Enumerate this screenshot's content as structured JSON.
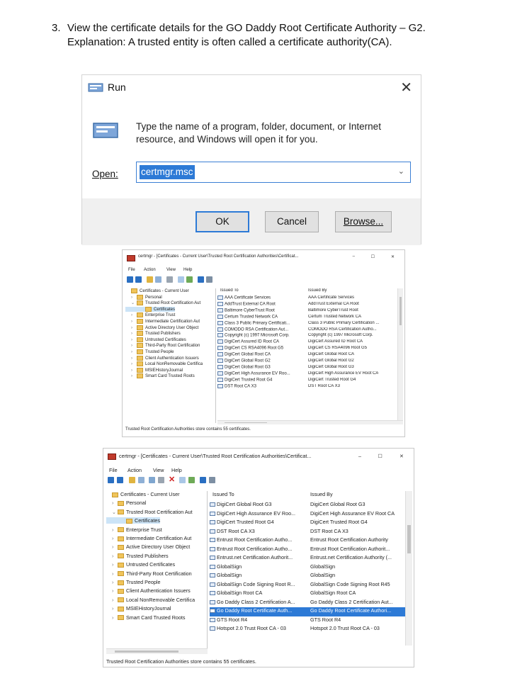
{
  "doc": {
    "step_number": "3.",
    "line1": "View the certificate details for the GO Daddy Root Certificate Authority – G2.",
    "line2": "Explanation: A trusted entity is often called a certificate authority(CA)."
  },
  "run_dialog": {
    "title": "Run",
    "close": "✕",
    "description": "Type the name of a program, folder, document, or Internet resource, and Windows will open it for you.",
    "open_label": "Open:",
    "open_value": "certmgr.msc",
    "ok_label": "OK",
    "cancel_label": "Cancel",
    "browse_label": "Browse..."
  },
  "certmgr1": {
    "title": "certmgr - [Certificates - Current User\\Trusted Root Certification Authorities\\Certificat...",
    "minimize": "–",
    "maximize": "☐",
    "close": "✕",
    "menu": [
      "File",
      "Action",
      "View",
      "Help"
    ],
    "tree": [
      {
        "label": "Certificates - Current User",
        "arrow": ""
      },
      {
        "label": "Personal",
        "arrow": "›"
      },
      {
        "label": "Trusted Root Certification Aut",
        "arrow": "⌄"
      },
      {
        "label": "Certificates",
        "arrow": ""
      },
      {
        "label": "Enterprise Trust",
        "arrow": "›"
      },
      {
        "label": "Intermediate Certification Aut",
        "arrow": "›"
      },
      {
        "label": "Active Directory User Object",
        "arrow": "›"
      },
      {
        "label": "Trusted Publishers",
        "arrow": "›"
      },
      {
        "label": "Untrusted Certificates",
        "arrow": "›"
      },
      {
        "label": "Third-Party Root Certification",
        "arrow": "›"
      },
      {
        "label": "Trusted People",
        "arrow": "›"
      },
      {
        "label": "Client Authentication Issuers",
        "arrow": "›"
      },
      {
        "label": "Local NonRemovable Certifica",
        "arrow": "›"
      },
      {
        "label": "MSIEHistoryJournal",
        "arrow": "›"
      },
      {
        "label": "Smart Card Trusted Roots",
        "arrow": "›"
      }
    ],
    "col_issued_to": "Issued To",
    "col_issued_by": "Issued By",
    "rows": [
      {
        "to": "AAA Certificate Services",
        "by": "AAA Certificate Services"
      },
      {
        "to": "AddTrust External CA Root",
        "by": "AddTrust External CA Root"
      },
      {
        "to": "Baltimore CyberTrust Root",
        "by": "Baltimore CyberTrust Root"
      },
      {
        "to": "Certum Trusted Network CA",
        "by": "Certum Trusted Network CA"
      },
      {
        "to": "Class 3 Public Primary Certificati...",
        "by": "Class 3 Public Primary Certification ..."
      },
      {
        "to": "COMODO RSA Certification Aut...",
        "by": "COMODO RSA Certification Autho..."
      },
      {
        "to": "Copyright (c) 1997 Microsoft Corp.",
        "by": "Copyright (c) 1997 Microsoft Corp."
      },
      {
        "to": "DigiCert Assured ID Root CA",
        "by": "DigiCert Assured ID Root CA"
      },
      {
        "to": "DigiCert CS RSA4096 Root G5",
        "by": "DigiCert CS RSA4096 Root G5"
      },
      {
        "to": "DigiCert Global Root CA",
        "by": "DigiCert Global Root CA"
      },
      {
        "to": "DigiCert Global Root G2",
        "by": "DigiCert Global Root G2"
      },
      {
        "to": "DigiCert Global Root G3",
        "by": "DigiCert Global Root G3"
      },
      {
        "to": "DigiCert High Assurance EV Roo...",
        "by": "DigiCert High Assurance EV Root CA"
      },
      {
        "to": "DigiCert Trusted Root G4",
        "by": "DigiCert Trusted Root G4"
      },
      {
        "to": "DST Root CA X3",
        "by": "DST Root CA X3"
      }
    ],
    "status": "Trusted Root Certification Authorities store contains 55 certificates."
  },
  "certmgr2": {
    "title": "certmgr - [Certificates - Current User\\Trusted Root Certification Authorities\\Certificat...",
    "minimize": "–",
    "maximize": "☐",
    "close": "✕",
    "menu": [
      "File",
      "Action",
      "View",
      "Help"
    ],
    "tree": [
      {
        "label": "Certificates - Current User",
        "arrow": ""
      },
      {
        "label": "Personal",
        "arrow": "›"
      },
      {
        "label": "Trusted Root Certification Aut",
        "arrow": "⌄"
      },
      {
        "label": "Certificates",
        "arrow": ""
      },
      {
        "label": "Enterprise Trust",
        "arrow": "›"
      },
      {
        "label": "Intermediate Certification Aut",
        "arrow": "›"
      },
      {
        "label": "Active Directory User Object",
        "arrow": "›"
      },
      {
        "label": "Trusted Publishers",
        "arrow": "›"
      },
      {
        "label": "Untrusted Certificates",
        "arrow": "›"
      },
      {
        "label": "Third-Party Root Certification",
        "arrow": "›"
      },
      {
        "label": "Trusted People",
        "arrow": "›"
      },
      {
        "label": "Client Authentication Issuers",
        "arrow": "›"
      },
      {
        "label": "Local NonRemovable Certifica",
        "arrow": "›"
      },
      {
        "label": "MSIEHistoryJournal",
        "arrow": "›"
      },
      {
        "label": "Smart Card Trusted Roots",
        "arrow": "›"
      }
    ],
    "col_issued_to": "Issued To",
    "col_issued_by": "Issued By",
    "rows": [
      {
        "to": "DigiCert Global Root G3",
        "by": "DigiCert Global Root G3"
      },
      {
        "to": "DigiCert High Assurance EV Roo...",
        "by": "DigiCert High Assurance EV Root CA"
      },
      {
        "to": "DigiCert Trusted Root G4",
        "by": "DigiCert Trusted Root G4"
      },
      {
        "to": "DST Root CA X3",
        "by": "DST Root CA X3"
      },
      {
        "to": "Entrust Root Certification Autho...",
        "by": "Entrust Root Certification Authority"
      },
      {
        "to": "Entrust Root Certification Autho...",
        "by": "Entrust Root Certification Authorit..."
      },
      {
        "to": "Entrust.net Certification Authorit...",
        "by": "Entrust.net Certification Authority (..."
      },
      {
        "to": "GlobalSign",
        "by": "GlobalSign"
      },
      {
        "to": "GlobalSign",
        "by": "GlobalSign"
      },
      {
        "to": "GlobalSign Code Signing Root R...",
        "by": "GlobalSign Code Signing Root R45"
      },
      {
        "to": "GlobalSign Root CA",
        "by": "GlobalSign Root CA"
      },
      {
        "to": "Go Daddy Class 2 Certification A...",
        "by": "Go Daddy Class 2 Certification Aut..."
      },
      {
        "to": "Go Daddy Root Certificate Auth...",
        "by": "Go Daddy Root Certificate Authori...",
        "selected": true
      },
      {
        "to": "GTS Root R4",
        "by": "GTS Root R4"
      },
      {
        "to": "Hotspot 2.0 Trust Root CA - 03",
        "by": "Hotspot 2.0 Trust Root CA - 03"
      }
    ],
    "status": "Trusted Root Certification Authorities store contains 55 certificates."
  },
  "colors": {
    "selection": "#2d7ad6",
    "folder": "#f0c45a",
    "dialog_footer": "#f0f0f0"
  },
  "icons": {
    "run_title": "run-icon",
    "run_big": "run-icon",
    "certmgr": "certmgr-icon",
    "folder": "folder-icon",
    "certificate": "certificate-icon"
  }
}
